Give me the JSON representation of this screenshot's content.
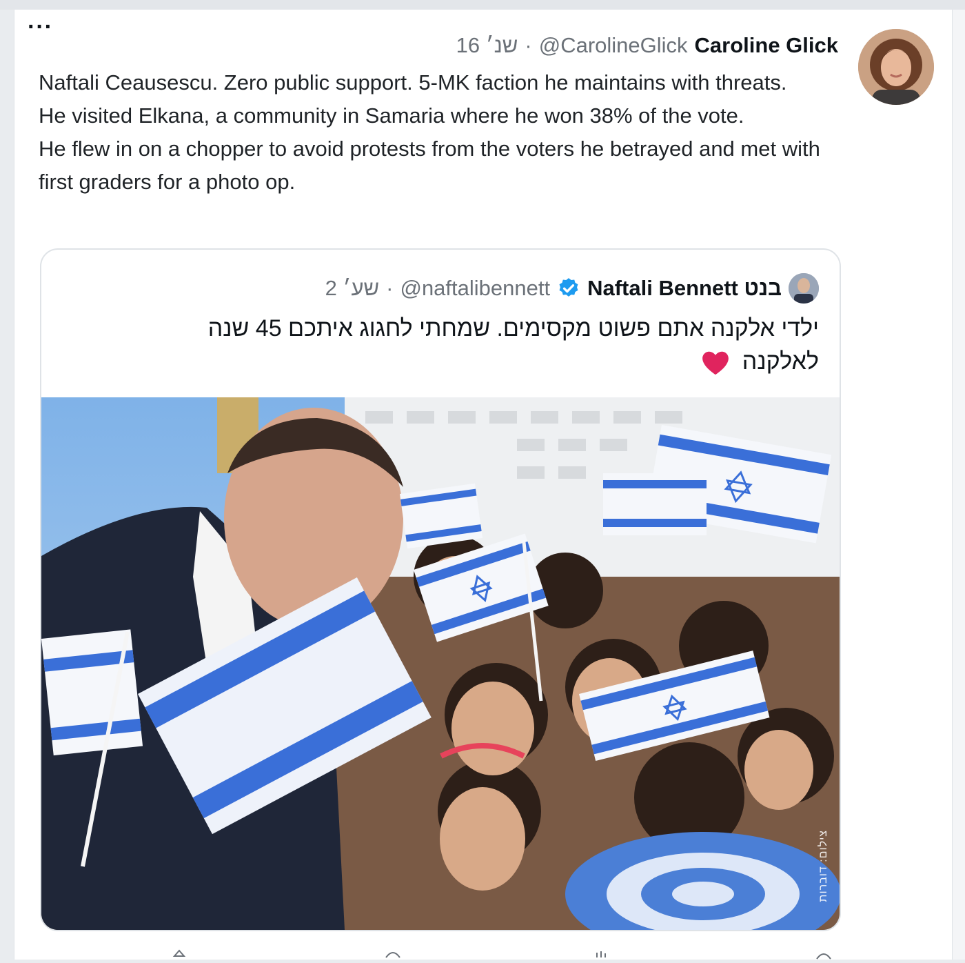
{
  "tweet": {
    "display_name": "Caroline Glick",
    "handle": "@CarolineGlick",
    "time": "16 שנ׳",
    "lines": [
      "Naftali Ceausescu. Zero public support. 5-MK faction he maintains with threats.",
      "He visited Elkana, a community in Samaria where he won 38% of the vote.",
      "He flew in on a chopper to avoid protests from the voters he betrayed and met with first graders for a photo op."
    ]
  },
  "quoted": {
    "display_name": "Naftali Bennett בנט",
    "handle": "@naftalibennett",
    "time": "2 שע׳",
    "text": "ילדי אלקנה אתם פשוט מקסימים. שמחתי לחגוג איתכם 45 שנה לאלקנה",
    "photo_credit": "צילום: דוברות"
  },
  "icons": {
    "more": "more-icon",
    "verified": "verified-badge-icon",
    "heart": "red-heart-icon",
    "reply": "reply-icon",
    "retweet": "retweet-icon",
    "like": "like-icon",
    "share": "share-icon"
  },
  "colors": {
    "verified": "#1d9bf0",
    "heart": "#e0245e",
    "muted_text": "#6b7178",
    "flag_blue": "#3a6fd8"
  }
}
